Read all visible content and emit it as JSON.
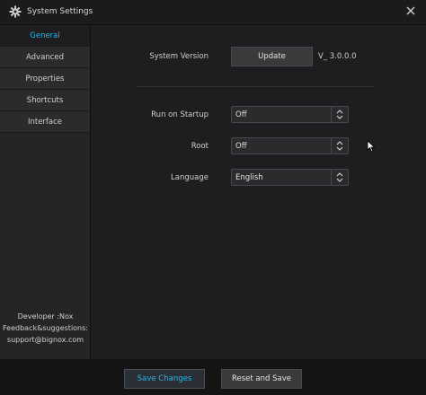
{
  "window": {
    "title": "System Settings"
  },
  "sidebar": {
    "items": [
      {
        "label": "General",
        "active": true
      },
      {
        "label": "Advanced",
        "active": false
      },
      {
        "label": "Properties",
        "active": false
      },
      {
        "label": "Shortcuts",
        "active": false
      },
      {
        "label": "Interface",
        "active": false
      }
    ],
    "footer": {
      "developer": "Developer :Nox",
      "feedback": "Feedback&suggestions:",
      "email": "support@bignox.com"
    }
  },
  "general": {
    "system_version_label": "System Version",
    "update_label": "Update",
    "version_value": "V_ 3.0.0.0",
    "run_on_startup_label": "Run on Startup",
    "run_on_startup_value": "Off",
    "root_label": "Root",
    "root_value": "Off",
    "language_label": "Language",
    "language_value": "English"
  },
  "actions": {
    "save_label": "Save Changes",
    "reset_label": "Reset and Save"
  },
  "colors": {
    "accent": "#29b7e8",
    "background": "#1e1e20"
  }
}
